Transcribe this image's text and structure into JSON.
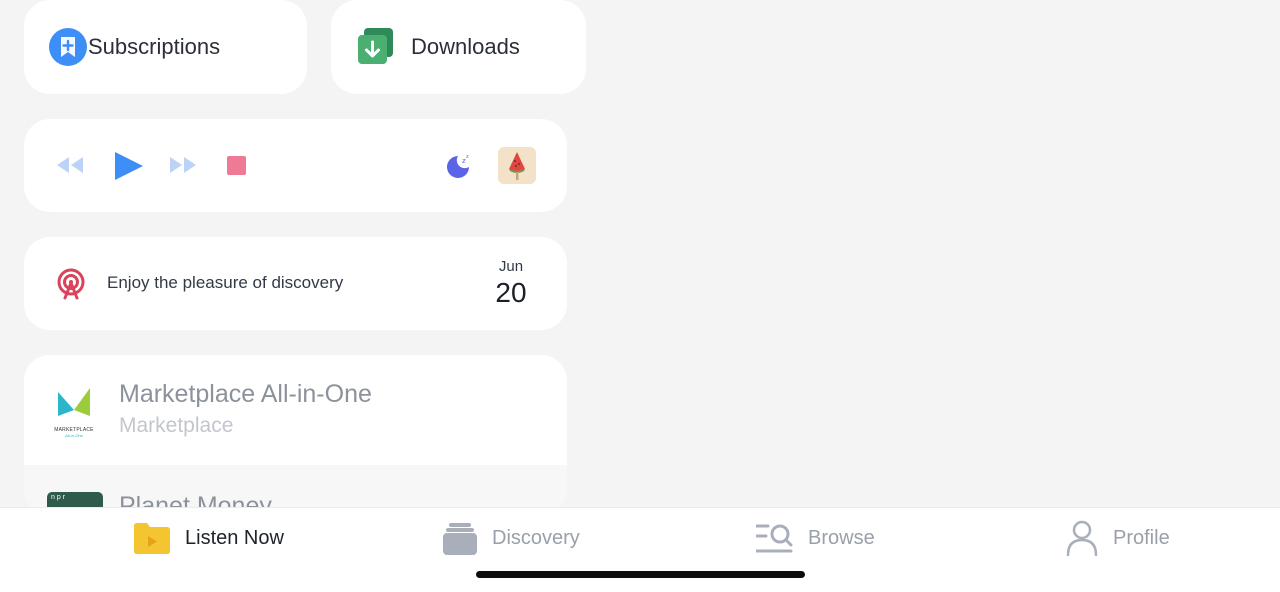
{
  "shortcuts": {
    "subscriptions_label": "Subscriptions",
    "downloads_label": "Downloads"
  },
  "player": {
    "controls": [
      "rewind-icon",
      "play-icon",
      "fast-forward-icon",
      "stop-icon",
      "sleep-timer-icon",
      "now-playing-artwork"
    ]
  },
  "discovery": {
    "text": "Enjoy the pleasure of discovery",
    "month": "Jun",
    "day": "20"
  },
  "podcasts": [
    {
      "title": "Marketplace All-in-One",
      "author": "Marketplace",
      "artwork_text": "MARKETPLACE",
      "artwork_subtext": "All-in-One"
    },
    {
      "title": "Planet Money",
      "author": "",
      "artwork_text": "npr"
    }
  ],
  "tabs": [
    {
      "label": "Listen Now",
      "icon": "folder-play-icon",
      "active": true
    },
    {
      "label": "Discovery",
      "icon": "stack-icon",
      "active": false
    },
    {
      "label": "Browse",
      "icon": "search-list-icon",
      "active": false
    },
    {
      "label": "Profile",
      "icon": "person-icon",
      "active": false
    }
  ],
  "colors": {
    "accent_blue": "#3e8ef7",
    "download_green": "#4caf72",
    "stop_pink": "#ee7a95",
    "discovery_red": "#d9445c",
    "folder_yellow": "#f5c431"
  }
}
